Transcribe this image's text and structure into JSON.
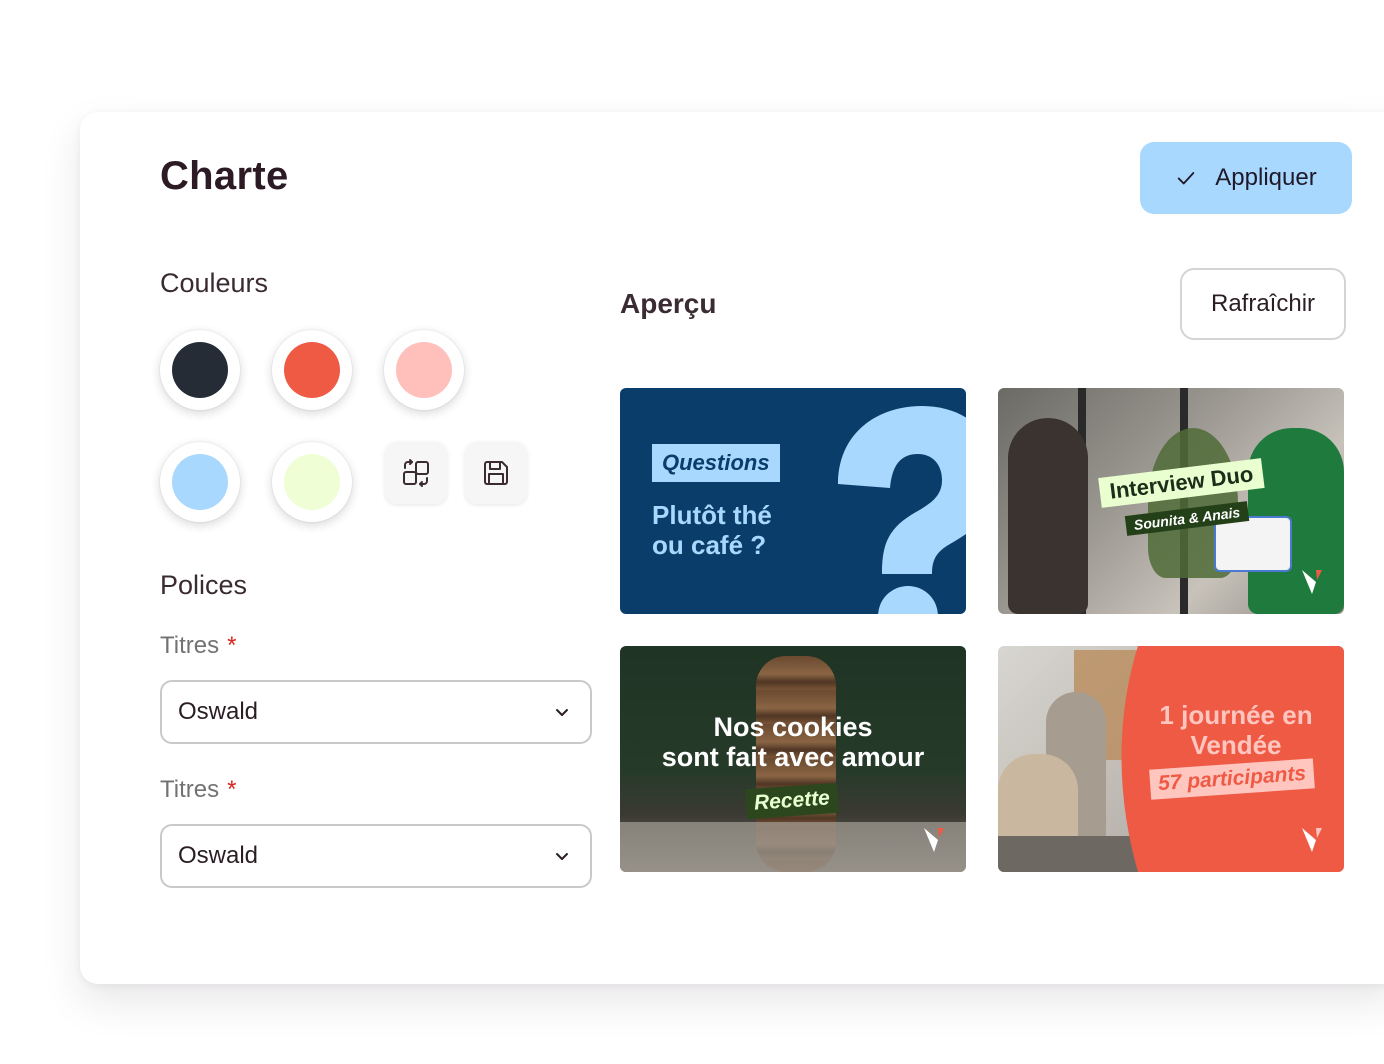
{
  "panel": {
    "title": "Charte",
    "apply_label": "Appliquer"
  },
  "colors": {
    "section_label": "Couleurs",
    "swatches": [
      "#262c36",
      "#ef5a45",
      "#ffc0bb",
      "#a9d8ff",
      "#effed4"
    ]
  },
  "fonts": {
    "section_label": "Polices",
    "fields": [
      {
        "label": "Titres",
        "required_mark": "*",
        "value": "Oswald"
      },
      {
        "label": "Titres",
        "required_mark": "*",
        "value": "Oswald"
      }
    ]
  },
  "preview": {
    "title": "Aperçu",
    "refresh_label": "Rafraîchir",
    "tiles": [
      {
        "tag": "Questions",
        "text_line1": "Plutôt thé",
        "text_line2": "ou café ?"
      },
      {
        "tag": "Interview Duo",
        "subtag": "Sounita & Anais"
      },
      {
        "text_line1": "Nos cookies",
        "text_line2": "sont fait avec amour",
        "tag": "Recette"
      },
      {
        "text_line1": "1 journée en",
        "text_line2": "Vendée",
        "tag": "57 participants"
      }
    ]
  },
  "icons": {
    "apply": "check-icon",
    "swap": "swap-icon",
    "save": "save-icon",
    "dropdown": "chevron-down-icon",
    "brand": "brand-logo-icon"
  }
}
